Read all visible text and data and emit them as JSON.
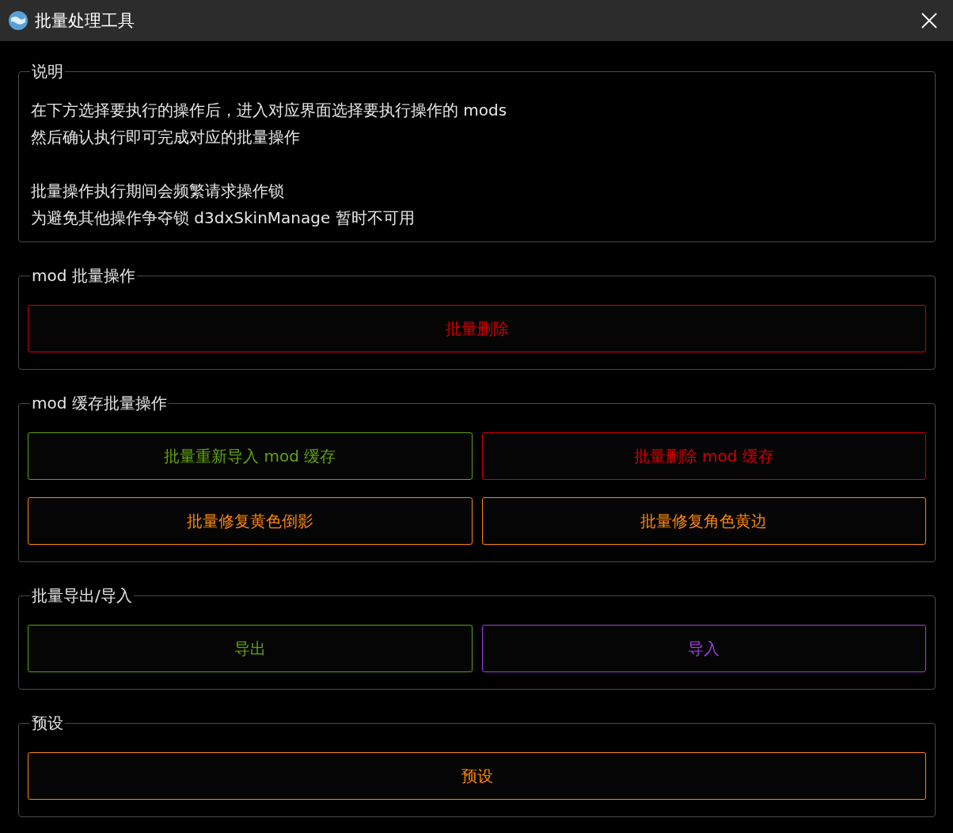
{
  "window": {
    "title": "批量处理工具"
  },
  "groups": [
    {
      "kind": "text",
      "title": "说明",
      "paragraphs": [
        [
          "在下方选择要执行的操作后，进入对应界面选择要执行操作的 mods",
          "然后确认执行即可完成对应的批量操作"
        ],
        [
          "批量操作执行期间会频繁请求操作锁",
          "为避免其他操作争夺锁 d3dxSkinManage 暂时不可用"
        ]
      ]
    },
    {
      "kind": "buttons",
      "title": "mod 批量操作",
      "buttons": [
        {
          "label": "批量删除",
          "color": "#d40000"
        }
      ]
    },
    {
      "kind": "buttons",
      "title": "mod 缓存批量操作",
      "buttons": [
        {
          "label": "批量重新导入 mod 缓存",
          "color": "#62a30a"
        },
        {
          "label": "批量删除 mod 缓存",
          "color": "#d40000"
        },
        {
          "label": "批量修复黄色倒影",
          "color": "#ff8800"
        },
        {
          "label": "批量修复角色黄边",
          "color": "#ff8800"
        }
      ]
    },
    {
      "kind": "buttons",
      "title": "批量导出/导入",
      "buttons": [
        {
          "label": "导出",
          "color": "#62a30a"
        },
        {
          "label": "导入",
          "color": "#a23ee0"
        }
      ]
    },
    {
      "kind": "buttons",
      "title": "预设",
      "buttons": [
        {
          "label": "预设",
          "color": "#ff8800"
        }
      ]
    }
  ]
}
